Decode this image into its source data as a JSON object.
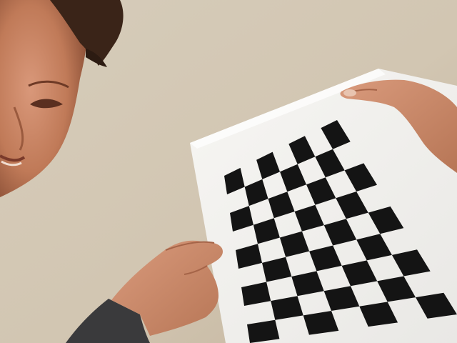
{
  "scene": {
    "checkerboard": {
      "rows": 9,
      "cols": 7,
      "dark_color": "#141414",
      "light_color": "#f4f4f2",
      "paper_color": "#f3f2ef"
    },
    "colors": {
      "wall": "#d2c7b4",
      "skin": "#c98563",
      "hair": "#3a2418",
      "sleeve": "#3a3a3c"
    }
  }
}
